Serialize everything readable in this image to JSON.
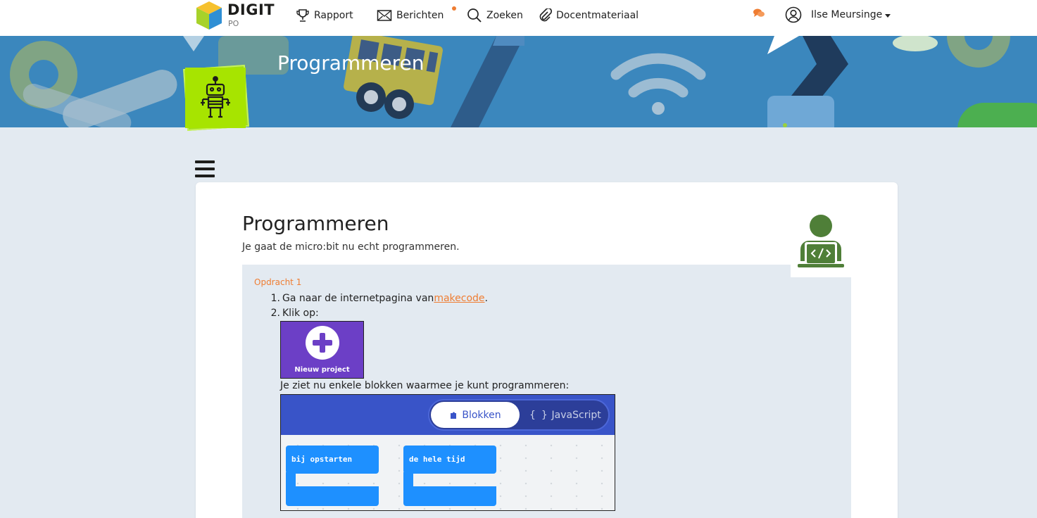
{
  "header": {
    "logo_text": "DIGIT",
    "logo_sub": "PO",
    "nav": [
      {
        "label": "Rapport",
        "icon": "trophy-icon"
      },
      {
        "label": "Berichten",
        "icon": "envelope-icon"
      },
      {
        "label": "Zoeken",
        "icon": "search-icon"
      },
      {
        "label": "Docentmateriaal",
        "icon": "paperclip-icon"
      }
    ],
    "user_name": "Ilse Meursinge",
    "accent": "#ef7d32"
  },
  "banner": {
    "title": "Programmeren",
    "background": "#3b87bd",
    "badge_color": "#a7e400"
  },
  "card": {
    "title": "Programmeren",
    "subtitle": "Je gaat de micro:bit nu echt programmeren.",
    "assignment": {
      "label": "Opdracht 1",
      "steps": [
        {
          "num": "1.",
          "before": "Ga naar de internetpagina van ",
          "link": "makecode",
          "after": "."
        },
        {
          "num": "2.",
          "text": "Klik op:"
        }
      ],
      "new_project_label": "Nieuw project",
      "info_line": "Je ziet nu enkele blokken waarmee je kunt programmeren:",
      "makecode": {
        "tab_blocks": "Blokken",
        "tab_js": "JavaScript",
        "block_start": "bij opstarten",
        "block_forever": "de hele tijd"
      }
    }
  }
}
